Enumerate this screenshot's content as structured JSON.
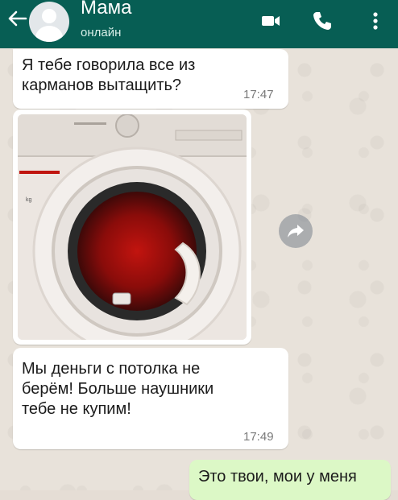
{
  "header": {
    "contact_name": "Мама",
    "status": "онлайн",
    "icons": [
      "back-arrow-icon",
      "avatar",
      "video-call-icon",
      "phone-icon",
      "more-vert-icon"
    ],
    "color": "#075e54"
  },
  "messages": [
    {
      "direction": "in",
      "type": "text",
      "text": "Я тебе говорила все из карманов вытащить?",
      "time": "17:47"
    },
    {
      "direction": "in",
      "type": "image",
      "image": "washing-machine-photo"
    },
    {
      "direction": "in",
      "type": "text",
      "text": "Мы деньги с потолка не берём! Больше наушники тебе не купим!",
      "time": "17:49"
    },
    {
      "direction": "out",
      "type": "text",
      "text": "Это твои, мои у меня"
    }
  ],
  "photo": {
    "panel_label": "kg"
  },
  "colors": {
    "incoming_bubble": "#ffffff",
    "outgoing_bubble": "#dcf8c6"
  }
}
